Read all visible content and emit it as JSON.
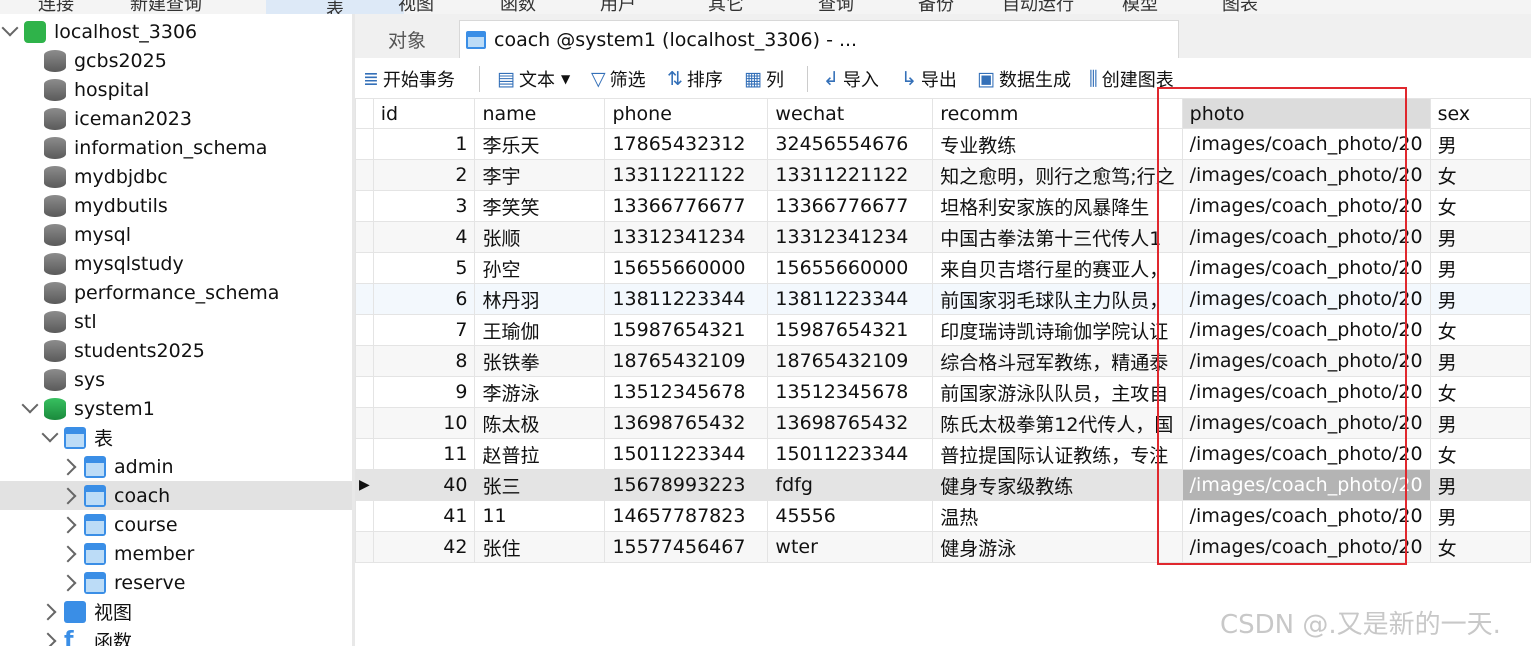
{
  "menubar": {
    "items": [
      "连接",
      "新建查询",
      "表",
      "视图",
      "函数",
      "用户",
      "其它",
      "查询",
      "备份",
      "自动运行",
      "模型",
      "图表"
    ]
  },
  "sidebar": {
    "connection": "localhost_3306",
    "databases": [
      "gcbs2025",
      "hospital",
      "iceman2023",
      "information_schema",
      "mydbjdbc",
      "mydbutils",
      "mysql",
      "mysqlstudy",
      "performance_schema",
      "stl",
      "students2025",
      "sys"
    ],
    "open_db": "system1",
    "tables_group": "表",
    "tables": [
      "admin",
      "coach",
      "course",
      "member",
      "reserve"
    ],
    "selected_table": "coach",
    "views_group": "视图",
    "functions_group": "函数"
  },
  "tabs": {
    "objects": "对象",
    "active": "coach @system1 (localhost_3306) - ..."
  },
  "toolbar": {
    "begin_tx": "开始事务",
    "text": "文本",
    "filter": "筛选",
    "sort": "排序",
    "columns": "列",
    "import": "导入",
    "export": "导出",
    "datagen": "数据生成",
    "chart": "创建图表"
  },
  "grid": {
    "columns": [
      "id",
      "name",
      "phone",
      "wechat",
      "recomm",
      "photo",
      "sex"
    ],
    "rows": [
      [
        "1",
        "李乐天",
        "17865432312",
        "32456554676",
        "专业教练",
        "/images/coach_photo/20",
        "男"
      ],
      [
        "2",
        "李宇",
        "13311221122",
        "13311221122",
        "知之愈明，则行之愈笃;行之",
        "/images/coach_photo/20",
        "女"
      ],
      [
        "3",
        "李笑笑",
        "13366776677",
        "13366776677",
        "坦格利安家族的风暴降生",
        "/images/coach_photo/20",
        "女"
      ],
      [
        "4",
        "张顺",
        "13312341234",
        "13312341234",
        "中国古拳法第十三代传人1",
        "/images/coach_photo/20",
        "男"
      ],
      [
        "5",
        "孙空",
        "15655660000",
        "15655660000",
        "来自贝吉塔行星的赛亚人，",
        "/images/coach_photo/20",
        "男"
      ],
      [
        "6",
        "林丹羽",
        "13811223344",
        "13811223344",
        "前国家羽毛球队主力队员，",
        "/images/coach_photo/20",
        "男"
      ],
      [
        "7",
        "王瑜伽",
        "15987654321",
        "15987654321",
        "印度瑞诗凯诗瑜伽学院认证",
        "/images/coach_photo/20",
        "女"
      ],
      [
        "8",
        "张铁拳",
        "18765432109",
        "18765432109",
        "综合格斗冠军教练，精通泰",
        "/images/coach_photo/20",
        "男"
      ],
      [
        "9",
        "李游泳",
        "13512345678",
        "13512345678",
        "前国家游泳队队员，主攻自",
        "/images/coach_photo/20",
        "女"
      ],
      [
        "10",
        "陈太极",
        "13698765432",
        "13698765432",
        "陈氏太极拳第12代传人，国",
        "/images/coach_photo/20",
        "男"
      ],
      [
        "11",
        "赵普拉",
        "15011223344",
        "15011223344",
        "普拉提国际认证教练，专注",
        "/images/coach_photo/20",
        "女"
      ],
      [
        "40",
        "张三",
        "15678993223",
        "fdfg",
        "健身专家级教练",
        "/images/coach_photo/20",
        "男"
      ],
      [
        "41",
        "11",
        "14657787823",
        "45556",
        "温热",
        "/images/coach_photo/20",
        "男"
      ],
      [
        "42",
        "张住",
        "15577456467",
        "wter",
        "健身游泳",
        "/images/coach_photo/20",
        "女"
      ]
    ],
    "current_row": 11
  },
  "watermark": "CSDN @.又是新的一天."
}
